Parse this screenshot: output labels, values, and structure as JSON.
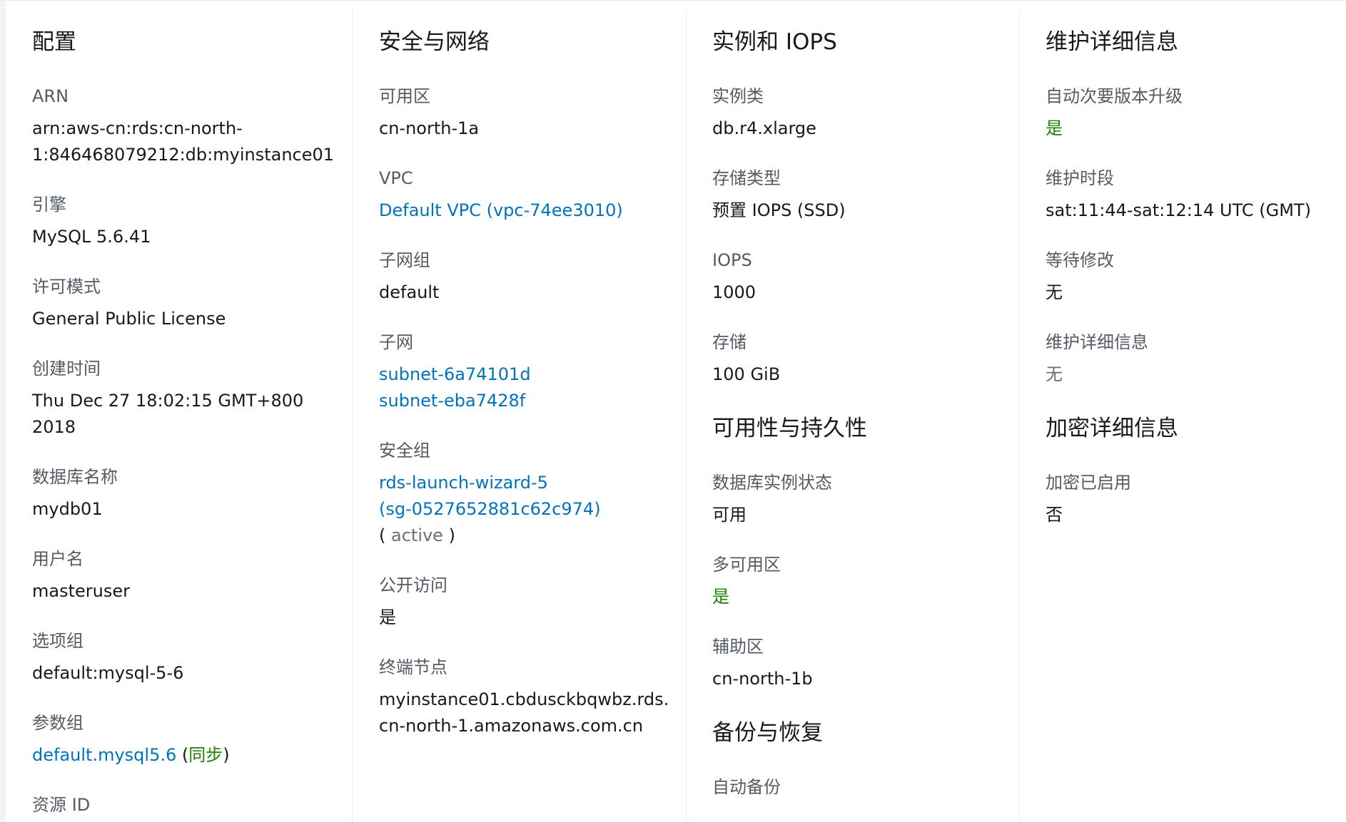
{
  "config": {
    "title": "配置",
    "arn_label": "ARN",
    "arn_line1": "arn:aws-cn:rds:cn-north-",
    "arn_line2": "1:846468079212:db:myinstance01",
    "engine_label": "引擎",
    "engine_value": "MySQL 5.6.41",
    "license_label": "许可模式",
    "license_value": "General Public License",
    "created_label": "创建时间",
    "created_line1": "Thu Dec 27 18:02:15 GMT+800",
    "created_line2": "2018",
    "dbname_label": "数据库名称",
    "dbname_value": "mydb01",
    "username_label": "用户名",
    "username_value": "masteruser",
    "optiongroup_label": "选项组",
    "optiongroup_value": "default:mysql-5-6",
    "paramgroup_label": "参数组",
    "paramgroup_link": "default.mysql5.6",
    "paramgroup_open": " (",
    "paramgroup_status": "同步",
    "paramgroup_close": ")",
    "resourceid_label": "资源 ID"
  },
  "security": {
    "title": "安全与网络",
    "az_label": "可用区",
    "az_value": "cn-north-1a",
    "vpc_label": "VPC",
    "vpc_link": "Default VPC (vpc-74ee3010)",
    "subnetgroup_label": "子网组",
    "subnetgroup_value": "default",
    "subnet_label": "子网",
    "subnets": [
      "subnet-6a74101d",
      "subnet-eba7428f"
    ],
    "sg_label": "安全组",
    "sg_link_line1": "rds-launch-wizard-5",
    "sg_link_line2": "(sg-0527652881c62c974)",
    "sg_status_open": "( ",
    "sg_status": "active",
    "sg_status_close": " )",
    "public_label": "公开访问",
    "public_value": "是",
    "endpoint_label": "终端节点",
    "endpoint_line1": "myinstance01.cbdusckbqwbz.rds.",
    "endpoint_line2": "cn-north-1.amazonaws.com.cn"
  },
  "instance": {
    "title": "实例和 IOPS",
    "class_label": "实例类",
    "class_value": "db.r4.xlarge",
    "storagetype_label": "存储类型",
    "storagetype_value": "预置 IOPS (SSD)",
    "iops_label": "IOPS",
    "iops_value": "1000",
    "storage_label": "存储",
    "storage_value": "100 GiB"
  },
  "availability": {
    "title": "可用性与持久性",
    "status_label": "数据库实例状态",
    "status_value": "可用",
    "multiaz_label": "多可用区",
    "multiaz_value": "是",
    "secondary_label": "辅助区",
    "secondary_value": "cn-north-1b"
  },
  "backup": {
    "title": "备份与恢复",
    "auto_label": "自动备份"
  },
  "maintenance": {
    "title": "维护详细信息",
    "autominor_label": "自动次要版本升级",
    "autominor_value": "是",
    "window_label": "维护时段",
    "window_value": "sat:11:44-sat:12:14 UTC (GMT)",
    "pending_label": "等待修改",
    "pending_value": "无",
    "details_label": "维护详细信息",
    "details_value": "无"
  },
  "encryption": {
    "title": "加密详细信息",
    "enabled_label": "加密已启用",
    "enabled_value": "否"
  },
  "colors": {
    "link": "#0073bb",
    "success": "#1d8102",
    "label": "#545b64",
    "text": "#16191f"
  }
}
